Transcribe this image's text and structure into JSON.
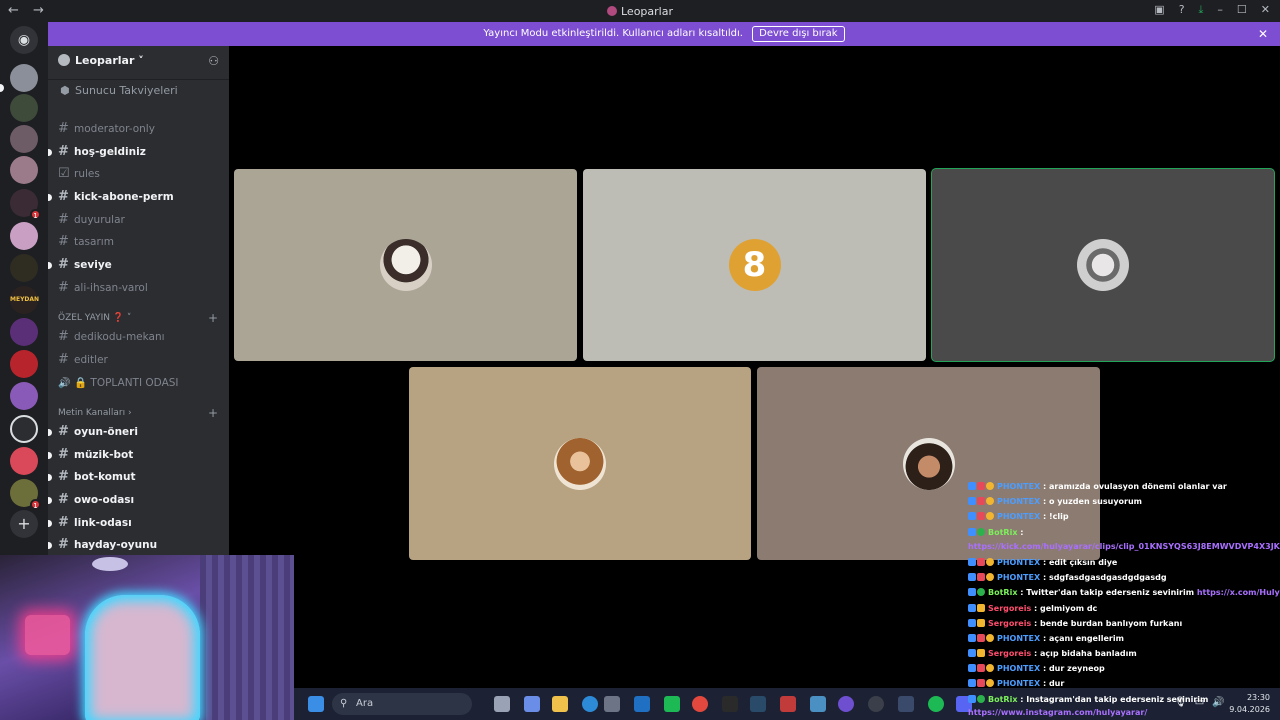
{
  "window": {
    "title": "Leoparlar",
    "back": "←",
    "forward": "→",
    "icons": [
      "inbox-icon",
      "help-icon",
      "download-icon"
    ],
    "controls": [
      "–",
      "☐",
      "✕"
    ]
  },
  "banner": {
    "text": "Yayıncı Modu etkinleştirildi. Kullanıcı adları kısaltıldı.",
    "button": "Devre dışı bırak",
    "close": "✕"
  },
  "server": {
    "name": "Leoparlar ˅",
    "boosts": "Sunucu Takviyeleri"
  },
  "channels": [
    {
      "name": "moderator-only",
      "unread": false,
      "icon": "#"
    },
    {
      "name": "hoş-geldiniz",
      "unread": true,
      "icon": "#"
    },
    {
      "name": "rules",
      "unread": false,
      "icon": "☑"
    },
    {
      "name": "kick-abone-perm",
      "unread": true,
      "icon": "#"
    },
    {
      "name": "duyurular",
      "unread": false,
      "icon": "#"
    },
    {
      "name": "tasarım",
      "unread": false,
      "icon": "#"
    },
    {
      "name": "seviye",
      "unread": true,
      "icon": "#"
    },
    {
      "name": "ali-ihsan-varol",
      "unread": false,
      "icon": "#"
    }
  ],
  "category1": {
    "name": "ÖZEL YAYIN ❓ ˅",
    "plus": "+"
  },
  "channels2": [
    {
      "name": "dedikodu-mekanı",
      "unread": false,
      "icon": "#"
    },
    {
      "name": "editler",
      "unread": false,
      "icon": "#"
    },
    {
      "name": "🔒 TOPLANTI ODASI",
      "unread": false,
      "icon": "🔊"
    }
  ],
  "category2": {
    "name": "Metin Kanalları ›",
    "plus": "+"
  },
  "channels3": [
    {
      "name": "oyun-öneri",
      "unread": true,
      "icon": "#"
    },
    {
      "name": "müzik-bot",
      "unread": true,
      "icon": "#"
    },
    {
      "name": "bot-komut",
      "unread": true,
      "icon": "#"
    },
    {
      "name": "owo-odası",
      "unread": true,
      "icon": "#"
    },
    {
      "name": "link-odası",
      "unread": true,
      "icon": "#"
    },
    {
      "name": "hayday-oyunu",
      "unread": true,
      "icon": "#"
    }
  ],
  "guild_badges": [
    "1",
    "1"
  ],
  "guild_add": "+",
  "guild_label_meydan": "MEYDAN",
  "tile_number": "8",
  "chat": [
    {
      "user": "PHONTEX",
      "text": ": aramızda ovulasyon dönemi olanlar var",
      "color": "#4d9dff"
    },
    {
      "user": "PHONTEX",
      "text": ": o yuzden susuyorum",
      "color": "#4d9dff"
    },
    {
      "user": "PHONTEX",
      "text": ": !clip",
      "color": "#4d9dff"
    },
    {
      "user": "BotRix",
      "text": " :",
      "color": "#7bf05b"
    },
    {
      "user": "",
      "text": "",
      "link": "https://kick.com/hulyayarar/clips/clip_01KNSYQS63J8EMWVDVP4X3JKZE",
      "color": "#a970ff"
    },
    {
      "user": "PHONTEX",
      "text": ": edit çıksın diye",
      "color": "#4d9dff"
    },
    {
      "user": "PHONTEX",
      "text": ": sdgfasdgasdgasdgdgasdg",
      "color": "#4d9dff"
    },
    {
      "user": "BotRix",
      "text": ": Twitter'dan takip ederseniz sevinirim ",
      "link": "https://x.com/Hulya_yarar",
      "color": "#7bf05b"
    },
    {
      "user": "Sergoreis",
      "text": ": gelmiyom dc",
      "color": "#ff4d6d"
    },
    {
      "user": "Sergoreis",
      "text": ": bende burdan banlıyom furkanı",
      "color": "#ff4d6d"
    },
    {
      "user": "PHONTEX",
      "text": ": açanı engellerim",
      "color": "#4d9dff"
    },
    {
      "user": "Sergoreis",
      "text": ": açıp bidaha banladım",
      "color": "#ff4d6d"
    },
    {
      "user": "PHONTEX",
      "text": ": dur zeyneop",
      "color": "#4d9dff"
    },
    {
      "user": "PHONTEX",
      "text": ": dur",
      "color": "#4d9dff"
    },
    {
      "user": "BotRix",
      "text": ": Instagram'dan takip ederseniz sevinirim",
      "color": "#7bf05b"
    },
    {
      "user": "",
      "text": "",
      "link": "https://www.instagram.com/hulyayarar/",
      "color": "#a970ff"
    }
  ],
  "taskbar": {
    "search": "Ara",
    "time": "23:30",
    "date": "9.04.2026"
  },
  "colors": {
    "accent": "#7e4ed2",
    "online": "#23a559",
    "sidebar": "#2b2d31"
  }
}
